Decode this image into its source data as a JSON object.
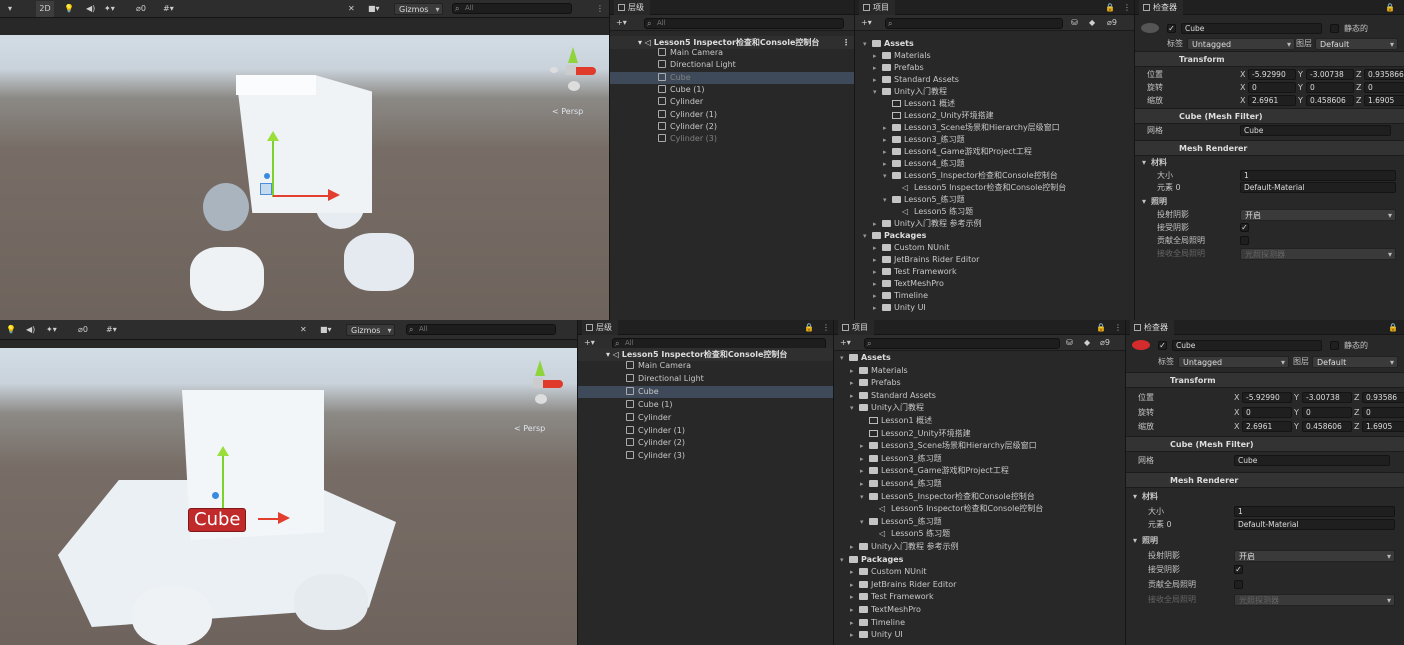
{
  "top": {
    "scene_toolbar": {
      "num": "2D",
      "lights": "0",
      "fx": "0",
      "gizmos": "Gizmos",
      "search_placeholder": "All"
    },
    "persp_label": "< Persp",
    "hierarchy": {
      "tab": "层级",
      "search_placeholder": "All",
      "scene": "Lesson5 Inspector检查和Console控制台",
      "items": [
        "Main Camera",
        "Directional Light",
        "Cube",
        "Cube (1)",
        "Cylinder",
        "Cylinder (1)",
        "Cylinder (2)",
        "Cylinder (3)"
      ]
    },
    "project": {
      "tab": "项目",
      "count": "9",
      "items": [
        "Assets",
        "Materials",
        "Prefabs",
        "Standard Assets",
        "Unity入门教程",
        "Lesson1 概述",
        "Lesson2_Unity环境搭建",
        "Lesson3_Scene场景和Hierarchy层级窗口",
        "Lesson3_练习题",
        "Lesson4_Game游戏和Project工程",
        "Lesson4_练习题",
        "Lesson5_Inspector检查和Console控制台",
        "Lesson5 Inspector检查和Console控制台",
        "Lesson5_练习题",
        "Lesson5 练习题",
        "Unity入门教程 参考示例",
        "Packages",
        "Custom NUnit",
        "JetBrains Rider Editor",
        "Test Framework",
        "TextMeshPro",
        "Timeline",
        "Unity UI"
      ]
    },
    "inspector": {
      "tab": "检查器",
      "object_name": "Cube",
      "static": "静态的",
      "tag_label": "标签",
      "tag": "Untagged",
      "layer_label": "图层",
      "layer": "Default",
      "transform": "Transform",
      "position_label": "位置",
      "rotation_label": "旋转",
      "scale_label": "缩放",
      "pos": [
        "-5.92990",
        "-3.00738",
        "0.935866"
      ],
      "rot": [
        "0",
        "0",
        "0"
      ],
      "scl": [
        "2.6961",
        "0.458606",
        "1.6905"
      ],
      "mesh_filter": "Cube (Mesh Filter)",
      "mesh_label": "网格",
      "mesh": "Cube",
      "mesh_renderer": "Mesh Renderer",
      "materials": "材料",
      "size_label": "大小",
      "size": "1",
      "element_label": "元素 0",
      "material": "Default-Material",
      "lighting": "照明",
      "cast_shadows_label": "投射阴影",
      "cast_shadows": "开启",
      "receive_shadows_label": "接受阴影",
      "gi_label": "贡献全局照明",
      "receive_gi_label": "接收全局照明",
      "receive_gi": "光照探测器"
    }
  },
  "bottom": {
    "scene_toolbar": {
      "lights": "0",
      "gizmos": "Gizmos",
      "search_placeholder": "All"
    },
    "persp_label": "< Persp",
    "cube_label": "Cube",
    "hierarchy": {
      "tab": "层级",
      "search_placeholder": "All",
      "scene": "Lesson5 Inspector检查和Console控制台",
      "items": [
        "Main Camera",
        "Directional Light",
        "Cube",
        "Cube (1)",
        "Cylinder",
        "Cylinder (1)",
        "Cylinder (2)",
        "Cylinder (3)"
      ]
    },
    "project": {
      "tab": "项目",
      "count": "9",
      "items": [
        "Assets",
        "Materials",
        "Prefabs",
        "Standard Assets",
        "Unity入门教程",
        "Lesson1 概述",
        "Lesson2_Unity环境搭建",
        "Lesson3_Scene场景和Hierarchy层级窗口",
        "Lesson3_练习题",
        "Lesson4_Game游戏和Project工程",
        "Lesson4_练习题",
        "Lesson5_Inspector检查和Console控制台",
        "Lesson5 Inspector检查和Console控制台",
        "Lesson5_练习题",
        "Lesson5 练习题",
        "Unity入门教程 参考示例",
        "Packages",
        "Custom NUnit",
        "JetBrains Rider Editor",
        "Test Framework",
        "TextMeshPro",
        "Timeline",
        "Unity UI"
      ]
    },
    "inspector": {
      "tab": "检查器",
      "object_name": "Cube",
      "static": "静态的",
      "tag_label": "标签",
      "tag": "Untagged",
      "layer_label": "图层",
      "layer": "Default",
      "transform": "Transform",
      "position_label": "位置",
      "rotation_label": "旋转",
      "scale_label": "缩放",
      "pos": [
        "-5.92990",
        "-3.00738",
        "0.93586"
      ],
      "rot": [
        "0",
        "0",
        "0"
      ],
      "scl": [
        "2.6961",
        "0.458606",
        "1.6905"
      ],
      "mesh_filter": "Cube (Mesh Filter)",
      "mesh_label": "网格",
      "mesh": "Cube",
      "mesh_renderer": "Mesh Renderer",
      "materials": "材料",
      "size_label": "大小",
      "size": "1",
      "element_label": "元素 0",
      "material": "Default-Material",
      "lighting": "照明",
      "cast_shadows_label": "投射阴影",
      "cast_shadows": "开启",
      "receive_shadows_label": "接受阴影",
      "gi_label": "贡献全局照明",
      "receive_gi_label": "接收全局照明",
      "receive_gi": "光照探测器"
    }
  },
  "colors": {
    "selection": "#3e4a5a",
    "label_red": "#c12a2a",
    "panel": "#282828"
  },
  "icons": [
    "menu-dots-icon",
    "lock-icon",
    "plus-icon",
    "search-icon",
    "folder-icon",
    "gameobject-icon",
    "scene-icon",
    "gear-icon",
    "help-icon",
    "preset-icon"
  ]
}
